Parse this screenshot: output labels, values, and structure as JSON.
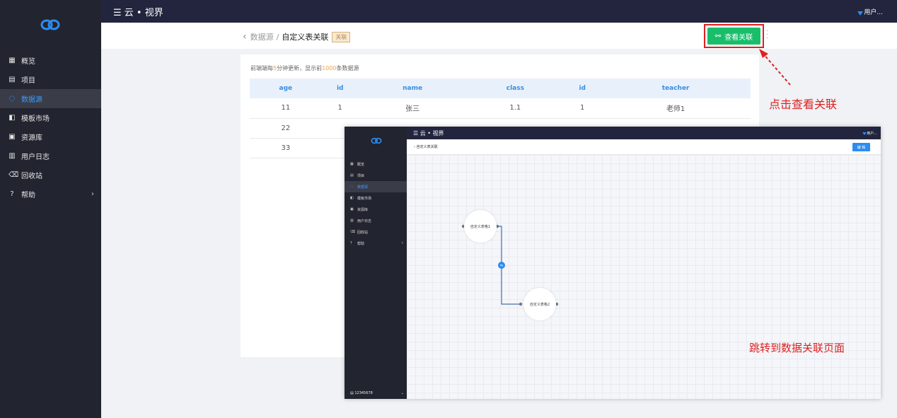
{
  "app": {
    "brand": "云 • 视界",
    "user": "用户...",
    "brand_color": "#2d8cf0",
    "nav": [
      {
        "icon": "grid-icon",
        "label": "概览"
      },
      {
        "icon": "list-icon",
        "label": "项目"
      },
      {
        "icon": "datasource-icon",
        "label": "数据源",
        "active": true
      },
      {
        "icon": "template-icon",
        "label": "模板市场"
      },
      {
        "icon": "library-icon",
        "label": "资源库"
      },
      {
        "icon": "log-icon",
        "label": "用户日志"
      },
      {
        "icon": "trash-icon",
        "label": "回收站"
      },
      {
        "icon": "help-icon",
        "label": "帮助",
        "has_submenu": true
      }
    ]
  },
  "breadcrumb": {
    "parent": "数据源",
    "sep": "/",
    "current": "自定义表关联",
    "tag": "关联"
  },
  "view_button": {
    "label": "查看关联",
    "icon": "link-icon",
    "color": "#19be6b"
  },
  "table_note": {
    "prefix": "前端端每",
    "minutes": "5",
    "mid": "分钟更新，显示前",
    "rows": "1000",
    "suffix": "条数据源"
  },
  "table": {
    "headers": [
      "age",
      "id",
      "name",
      "class",
      "id",
      "teacher"
    ],
    "rows": [
      [
        "11",
        "1",
        "张三",
        "1.1",
        "1",
        "老师1"
      ],
      [
        "22",
        "",
        "",
        "",
        "",
        ""
      ],
      [
        "33",
        "",
        "",
        "",
        "",
        ""
      ]
    ]
  },
  "annotations": {
    "click_hint": "点击查看关联",
    "jump_hint": "跳转到数据关联页面",
    "color": "#e02020"
  },
  "inset": {
    "brand": "云 • 视界",
    "user": "用户...",
    "crumb": "自定义表关联",
    "edit_button": "编 辑",
    "footer_id": "12345678",
    "nav": [
      {
        "icon": "grid-icon",
        "label": "概览"
      },
      {
        "icon": "list-icon",
        "label": "项目"
      },
      {
        "icon": "datasource-icon",
        "label": "数据源",
        "active": true
      },
      {
        "icon": "template-icon",
        "label": "模板市场"
      },
      {
        "icon": "library-icon",
        "label": "资源库"
      },
      {
        "icon": "log-icon",
        "label": "用户日志"
      },
      {
        "icon": "trash-icon",
        "label": "回收站"
      },
      {
        "icon": "help-icon",
        "label": "帮助",
        "has_submenu": true
      }
    ],
    "nodes": [
      {
        "label": "自定义表格1"
      },
      {
        "label": "自定义表格2"
      }
    ]
  }
}
